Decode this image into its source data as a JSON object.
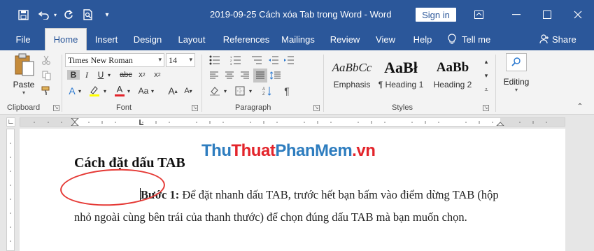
{
  "window": {
    "title": "2019-09-25 Cách xóa Tab trong Word  -  Word",
    "sign_in": "Sign in"
  },
  "tabs": [
    {
      "label": "File"
    },
    {
      "label": "Home"
    },
    {
      "label": "Insert"
    },
    {
      "label": "Design"
    },
    {
      "label": "Layout"
    },
    {
      "label": "References"
    },
    {
      "label": "Mailings"
    },
    {
      "label": "Review"
    },
    {
      "label": "View"
    },
    {
      "label": "Help"
    }
  ],
  "tell_me": "Tell me",
  "share": "Share",
  "ribbon": {
    "clipboard": {
      "paste": "Paste",
      "label": "Clipboard"
    },
    "font": {
      "name": "Times New Roman",
      "size": "14",
      "label": "Font"
    },
    "paragraph": {
      "label": "Paragraph"
    },
    "styles": {
      "label": "Styles",
      "items": [
        {
          "sample": "AaBbCc",
          "name": "Emphasis"
        },
        {
          "sample": "AaBł",
          "name": "¶ Heading 1"
        },
        {
          "sample": "AaBb",
          "name": "Heading 2"
        }
      ]
    },
    "editing": {
      "label": "Editing"
    }
  },
  "document": {
    "heading": "Cách đặt dấu TAB",
    "bold_lead": "Bước 1:",
    "paragraph": " Để đặt nhanh dấu TAB, trước hết bạn bấm vào điểm dừng TAB (hộp nhỏ ngoài cùng bên trái của thanh thước) để chọn đúng dấu TAB mà bạn muốn chọn."
  },
  "watermark": {
    "part1": "Thu",
    "part2": "Thuat",
    "part3": "PhanMem",
    "part4": ".vn"
  },
  "colors": {
    "accent": "#2b579a",
    "highlight_ring": "#e53935"
  }
}
